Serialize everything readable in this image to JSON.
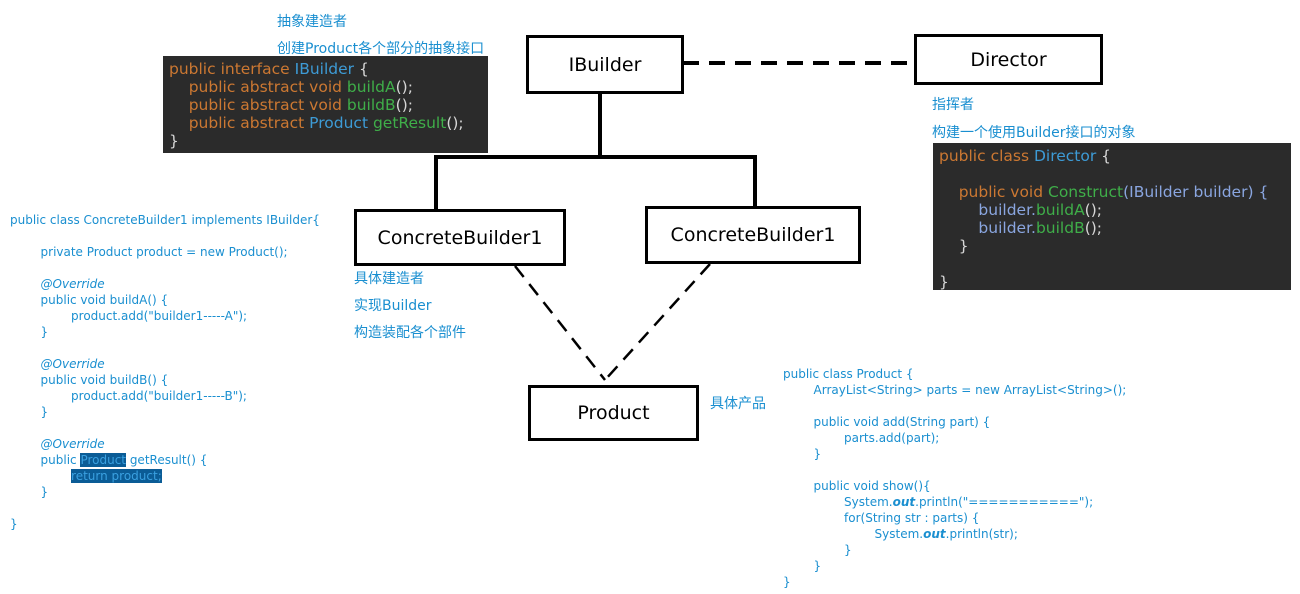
{
  "colors": {
    "kw": "#cc7832",
    "type": "#3d9bd6",
    "fn": "#3fae49",
    "plain": "#d6d6d6",
    "var": "#8aa6e0",
    "light": "#1a8fd0",
    "hl_bg": "#0b5c96",
    "dark_bg": "#2b2b2b"
  },
  "boxes": {
    "ibuilder": "IBuilder",
    "director": "Director",
    "concrete_left": "ConcreteBuilder1",
    "concrete_right": "ConcreteBuilder1",
    "product": "Product"
  },
  "notes": {
    "ibuilder_1": "抽象建造者",
    "ibuilder_2": "创建Product各个部分的抽象接口",
    "director_1": "指挥者",
    "director_2": "构建一个使用Builder接口的对象",
    "concrete_1": "具体建造者",
    "concrete_2": "实现Builder",
    "concrete_3": "构造装配各个部件",
    "product_1": "具体产品"
  },
  "ibuilder_code": [
    [
      [
        "public interface ",
        "kw"
      ],
      [
        "IBuilder",
        "type"
      ],
      [
        " {",
        "plain"
      ]
    ],
    [
      [
        "    public abstract void ",
        "kw"
      ],
      [
        "buildA",
        "fn"
      ],
      [
        "();",
        "plain"
      ]
    ],
    [
      [
        "    public abstract void ",
        "kw"
      ],
      [
        "buildB",
        "fn"
      ],
      [
        "();",
        "plain"
      ]
    ],
    [
      [
        "    public abstract ",
        "kw"
      ],
      [
        "Product",
        "type"
      ],
      [
        " getResult",
        "fn"
      ],
      [
        "();",
        "plain"
      ]
    ],
    [
      [
        "}",
        "plain"
      ]
    ]
  ],
  "director_code": [
    [
      [
        "public class ",
        "kw"
      ],
      [
        "Director",
        "type"
      ],
      [
        " {",
        "plain"
      ]
    ],
    [
      [
        "",
        "plain"
      ]
    ],
    [
      [
        "    public void ",
        "kw"
      ],
      [
        "Construct",
        "fn"
      ],
      [
        "(IBuilder builder) {",
        "var"
      ]
    ],
    [
      [
        "        builder.",
        "var"
      ],
      [
        "buildA",
        "fn"
      ],
      [
        "();",
        "plain"
      ]
    ],
    [
      [
        "        builder.",
        "var"
      ],
      [
        "buildB",
        "fn"
      ],
      [
        "();",
        "plain"
      ]
    ],
    [
      [
        "    }",
        "plain"
      ]
    ],
    [
      [
        "",
        "plain"
      ]
    ],
    [
      [
        "}",
        "plain"
      ]
    ]
  ],
  "concrete_code": [
    [
      [
        "public class ConcreteBuilder1 implements IBuilder{",
        ""
      ]
    ],
    [
      [
        "",
        ""
      ]
    ],
    [
      [
        "        private Product product = new Product();",
        ""
      ]
    ],
    [
      [
        "",
        ""
      ]
    ],
    [
      [
        "        @Override",
        "it"
      ]
    ],
    [
      [
        "        public void buildA() {",
        ""
      ]
    ],
    [
      [
        "                product.add(\"builder1-----A\");",
        ""
      ]
    ],
    [
      [
        "        }",
        ""
      ]
    ],
    [
      [
        "",
        ""
      ]
    ],
    [
      [
        "        @Override",
        "it"
      ]
    ],
    [
      [
        "        public void buildB() {",
        ""
      ]
    ],
    [
      [
        "                product.add(\"builder1-----B\");",
        ""
      ]
    ],
    [
      [
        "        }",
        ""
      ]
    ],
    [
      [
        "",
        ""
      ]
    ],
    [
      [
        "        @Override",
        "it"
      ]
    ],
    [
      [
        "        public ",
        ""
      ],
      [
        "Product",
        "hl"
      ],
      [
        " getResult() {",
        ""
      ]
    ],
    [
      [
        "                ",
        ""
      ],
      [
        "return product;",
        "hl"
      ]
    ],
    [
      [
        "        }",
        ""
      ]
    ],
    [
      [
        "",
        ""
      ]
    ],
    [
      [
        "}",
        ""
      ]
    ]
  ],
  "product_code": [
    [
      [
        "public class Product {",
        ""
      ]
    ],
    [
      [
        "        ArrayList<String> parts = new ArrayList<String>();",
        ""
      ]
    ],
    [
      [
        "",
        ""
      ]
    ],
    [
      [
        "        public void add(String part) {",
        ""
      ]
    ],
    [
      [
        "                parts.add(part);",
        ""
      ]
    ],
    [
      [
        "        }",
        ""
      ]
    ],
    [
      [
        "",
        ""
      ]
    ],
    [
      [
        "        public void show(){",
        ""
      ]
    ],
    [
      [
        "                System.",
        ""
      ],
      [
        "out",
        "bi"
      ],
      [
        ".println(\"===========\");",
        ""
      ]
    ],
    [
      [
        "                for(String str : parts) {",
        ""
      ]
    ],
    [
      [
        "                        System.",
        ""
      ],
      [
        "out",
        "bi"
      ],
      [
        ".println(str);",
        ""
      ]
    ],
    [
      [
        "                }",
        ""
      ]
    ],
    [
      [
        "        }",
        ""
      ]
    ],
    [
      [
        "}",
        ""
      ]
    ]
  ]
}
